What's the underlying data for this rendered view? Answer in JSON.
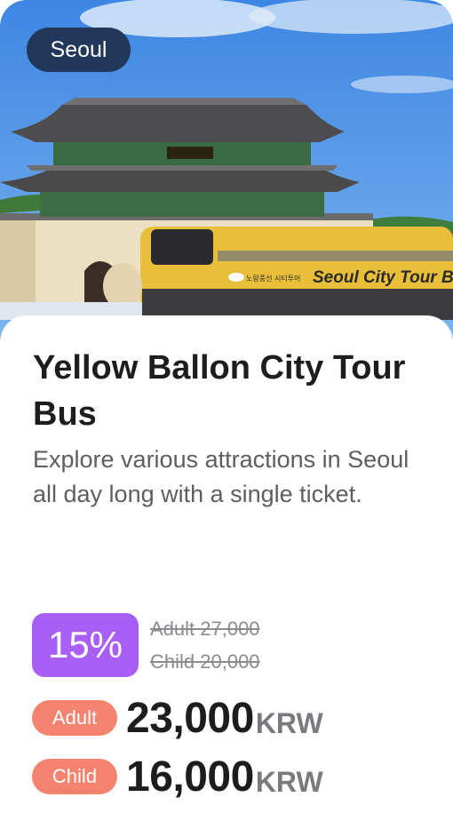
{
  "location": "Seoul",
  "tour": {
    "title": "Yellow Ballon City Tour Bus",
    "description": "Explore various attractions in Seoul all day long with a single ticket."
  },
  "discount": {
    "percent_label": "15%",
    "original_adult": "Adult 27,000",
    "original_child": "Child 20,000"
  },
  "prices": {
    "adult": {
      "label": "Adult",
      "amount": "23,000",
      "currency": "KRW"
    },
    "child": {
      "label": "Child",
      "amount": "16,000",
      "currency": "KRW"
    }
  },
  "photo": {
    "bus_text": "Seoul City Tour Bu",
    "bus_small_text": "노랑풍선 시티투어"
  },
  "colors": {
    "location_badge": "#22385a",
    "discount_badge": "#a95ef5",
    "price_pill": "#f5836f"
  }
}
